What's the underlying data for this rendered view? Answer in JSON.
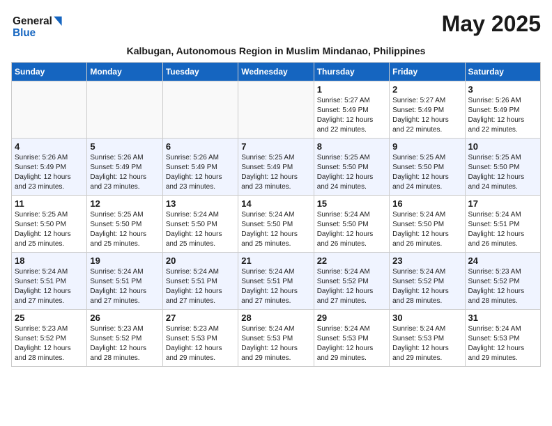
{
  "header": {
    "logo_line1": "General",
    "logo_line2": "Blue",
    "month": "May 2025",
    "subtitle": "Kalbugan, Autonomous Region in Muslim Mindanao, Philippines"
  },
  "days_of_week": [
    "Sunday",
    "Monday",
    "Tuesday",
    "Wednesday",
    "Thursday",
    "Friday",
    "Saturday"
  ],
  "weeks": [
    [
      {
        "day": "",
        "info": ""
      },
      {
        "day": "",
        "info": ""
      },
      {
        "day": "",
        "info": ""
      },
      {
        "day": "",
        "info": ""
      },
      {
        "day": "1",
        "info": "Sunrise: 5:27 AM\nSunset: 5:49 PM\nDaylight: 12 hours and 22 minutes."
      },
      {
        "day": "2",
        "info": "Sunrise: 5:27 AM\nSunset: 5:49 PM\nDaylight: 12 hours and 22 minutes."
      },
      {
        "day": "3",
        "info": "Sunrise: 5:26 AM\nSunset: 5:49 PM\nDaylight: 12 hours and 22 minutes."
      }
    ],
    [
      {
        "day": "4",
        "info": "Sunrise: 5:26 AM\nSunset: 5:49 PM\nDaylight: 12 hours and 23 minutes."
      },
      {
        "day": "5",
        "info": "Sunrise: 5:26 AM\nSunset: 5:49 PM\nDaylight: 12 hours and 23 minutes."
      },
      {
        "day": "6",
        "info": "Sunrise: 5:26 AM\nSunset: 5:49 PM\nDaylight: 12 hours and 23 minutes."
      },
      {
        "day": "7",
        "info": "Sunrise: 5:25 AM\nSunset: 5:49 PM\nDaylight: 12 hours and 23 minutes."
      },
      {
        "day": "8",
        "info": "Sunrise: 5:25 AM\nSunset: 5:50 PM\nDaylight: 12 hours and 24 minutes."
      },
      {
        "day": "9",
        "info": "Sunrise: 5:25 AM\nSunset: 5:50 PM\nDaylight: 12 hours and 24 minutes."
      },
      {
        "day": "10",
        "info": "Sunrise: 5:25 AM\nSunset: 5:50 PM\nDaylight: 12 hours and 24 minutes."
      }
    ],
    [
      {
        "day": "11",
        "info": "Sunrise: 5:25 AM\nSunset: 5:50 PM\nDaylight: 12 hours and 25 minutes."
      },
      {
        "day": "12",
        "info": "Sunrise: 5:25 AM\nSunset: 5:50 PM\nDaylight: 12 hours and 25 minutes."
      },
      {
        "day": "13",
        "info": "Sunrise: 5:24 AM\nSunset: 5:50 PM\nDaylight: 12 hours and 25 minutes."
      },
      {
        "day": "14",
        "info": "Sunrise: 5:24 AM\nSunset: 5:50 PM\nDaylight: 12 hours and 25 minutes."
      },
      {
        "day": "15",
        "info": "Sunrise: 5:24 AM\nSunset: 5:50 PM\nDaylight: 12 hours and 26 minutes."
      },
      {
        "day": "16",
        "info": "Sunrise: 5:24 AM\nSunset: 5:50 PM\nDaylight: 12 hours and 26 minutes."
      },
      {
        "day": "17",
        "info": "Sunrise: 5:24 AM\nSunset: 5:51 PM\nDaylight: 12 hours and 26 minutes."
      }
    ],
    [
      {
        "day": "18",
        "info": "Sunrise: 5:24 AM\nSunset: 5:51 PM\nDaylight: 12 hours and 27 minutes."
      },
      {
        "day": "19",
        "info": "Sunrise: 5:24 AM\nSunset: 5:51 PM\nDaylight: 12 hours and 27 minutes."
      },
      {
        "day": "20",
        "info": "Sunrise: 5:24 AM\nSunset: 5:51 PM\nDaylight: 12 hours and 27 minutes."
      },
      {
        "day": "21",
        "info": "Sunrise: 5:24 AM\nSunset: 5:51 PM\nDaylight: 12 hours and 27 minutes."
      },
      {
        "day": "22",
        "info": "Sunrise: 5:24 AM\nSunset: 5:52 PM\nDaylight: 12 hours and 27 minutes."
      },
      {
        "day": "23",
        "info": "Sunrise: 5:24 AM\nSunset: 5:52 PM\nDaylight: 12 hours and 28 minutes."
      },
      {
        "day": "24",
        "info": "Sunrise: 5:23 AM\nSunset: 5:52 PM\nDaylight: 12 hours and 28 minutes."
      }
    ],
    [
      {
        "day": "25",
        "info": "Sunrise: 5:23 AM\nSunset: 5:52 PM\nDaylight: 12 hours and 28 minutes."
      },
      {
        "day": "26",
        "info": "Sunrise: 5:23 AM\nSunset: 5:52 PM\nDaylight: 12 hours and 28 minutes."
      },
      {
        "day": "27",
        "info": "Sunrise: 5:23 AM\nSunset: 5:53 PM\nDaylight: 12 hours and 29 minutes."
      },
      {
        "day": "28",
        "info": "Sunrise: 5:24 AM\nSunset: 5:53 PM\nDaylight: 12 hours and 29 minutes."
      },
      {
        "day": "29",
        "info": "Sunrise: 5:24 AM\nSunset: 5:53 PM\nDaylight: 12 hours and 29 minutes."
      },
      {
        "day": "30",
        "info": "Sunrise: 5:24 AM\nSunset: 5:53 PM\nDaylight: 12 hours and 29 minutes."
      },
      {
        "day": "31",
        "info": "Sunrise: 5:24 AM\nSunset: 5:53 PM\nDaylight: 12 hours and 29 minutes."
      }
    ]
  ]
}
